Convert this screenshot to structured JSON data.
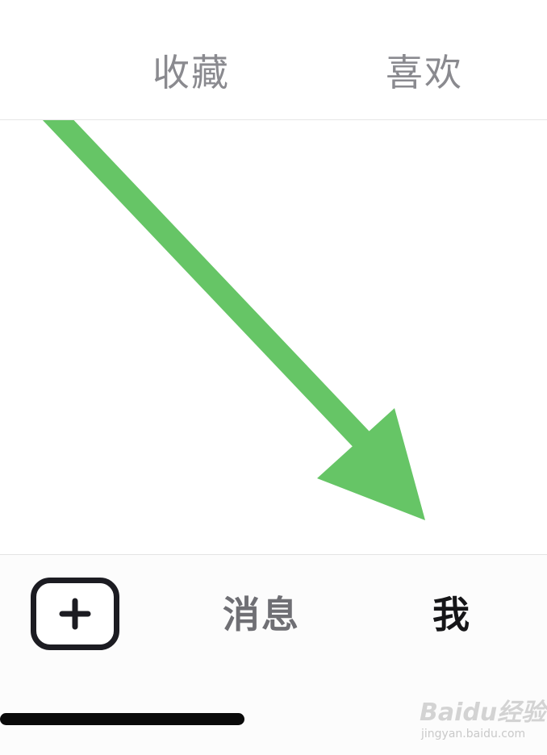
{
  "top_tabs": {
    "favorites": "收藏",
    "likes": "喜欢"
  },
  "bottom_nav": {
    "messages": "消息",
    "me": "我",
    "publish_icon": "plus-square-icon"
  },
  "annotation": {
    "icon": "arrow-icon",
    "color": "#66c566"
  },
  "watermark": {
    "logo": "Baidu经验",
    "url": "jingyan.baidu.com"
  },
  "colors": {
    "tab_inactive": "#8a8a8f",
    "nav_active": "#161618",
    "nav_inactive": "#6f6f74",
    "icon_stroke": "#1c1c22"
  }
}
